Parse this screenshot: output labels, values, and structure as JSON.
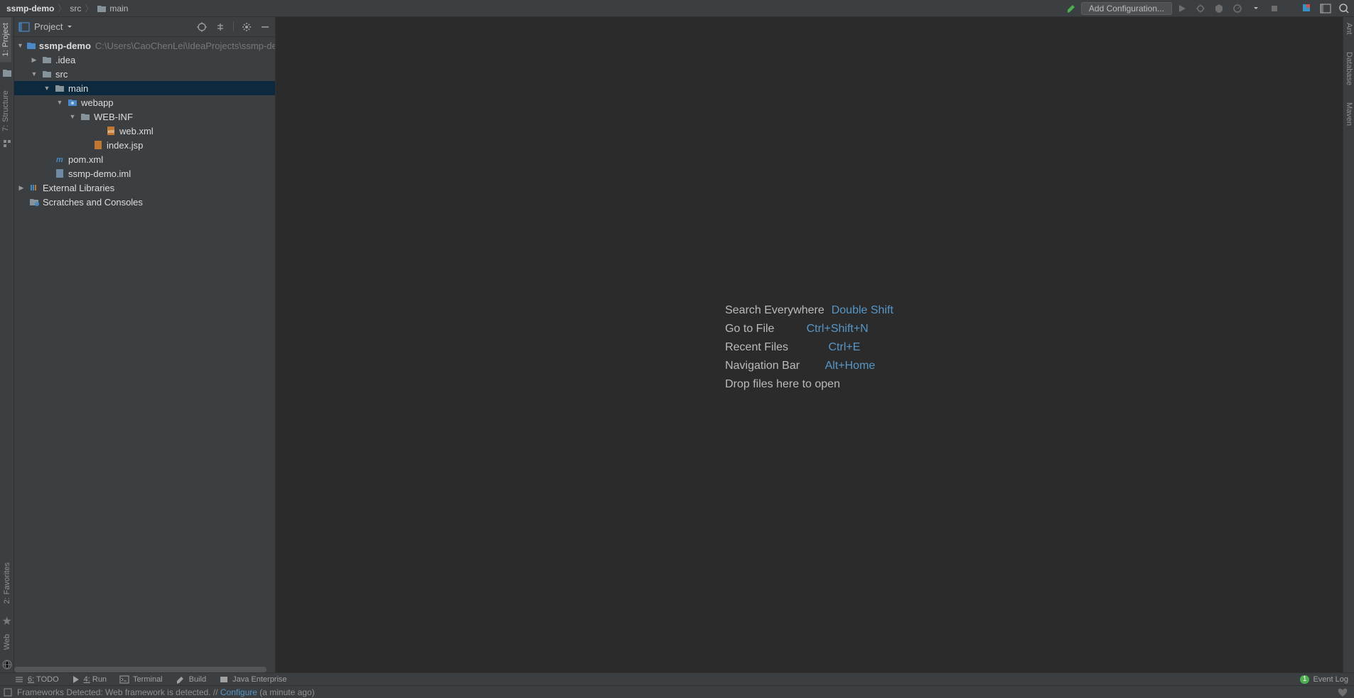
{
  "breadcrumb": {
    "root": "ssmp-demo",
    "items": [
      "src",
      "main"
    ]
  },
  "topbar": {
    "config_button": "Add Configuration..."
  },
  "project_panel": {
    "title": "Project"
  },
  "tree": {
    "root": {
      "name": "ssmp-demo",
      "path": "C:\\Users\\CaoChenLei\\IdeaProjects\\ssmp-demo"
    },
    "idea": ".idea",
    "src": "src",
    "main": "main",
    "webapp": "webapp",
    "webinf": "WEB-INF",
    "webxml": "web.xml",
    "indexjsp": "index.jsp",
    "pom": "pom.xml",
    "iml": "ssmp-demo.iml",
    "ext_libs": "External Libraries",
    "scratches": "Scratches and Consoles"
  },
  "welcome": {
    "rows": [
      {
        "label": "Search Everywhere",
        "shortcut": "Double Shift"
      },
      {
        "label": "Go to File",
        "shortcut": "Ctrl+Shift+N"
      },
      {
        "label": "Recent Files",
        "shortcut": "Ctrl+E"
      },
      {
        "label": "Navigation Bar",
        "shortcut": "Alt+Home"
      }
    ],
    "drop": "Drop files here to open"
  },
  "bottom_tools": {
    "todo_n": "6:",
    "todo": " TODO",
    "run_n": "4:",
    "run": " Run",
    "terminal": "Terminal",
    "build": "Build",
    "jee": "Java Enterprise",
    "event_log": "Event Log",
    "event_badge": "1"
  },
  "left_tabs": {
    "project_n": "1:",
    "project": " Project",
    "structure_n": "7:",
    "structure": " Structure",
    "favorites_n": "2:",
    "favorites": " Favorites",
    "web": "Web"
  },
  "right_tabs": {
    "ant": "Ant",
    "database": "Database",
    "maven": "Maven"
  },
  "status": {
    "message_prefix": "Frameworks Detected: Web framework is detected. // ",
    "link": "Configure",
    "message_suffix": " (a minute ago)"
  }
}
